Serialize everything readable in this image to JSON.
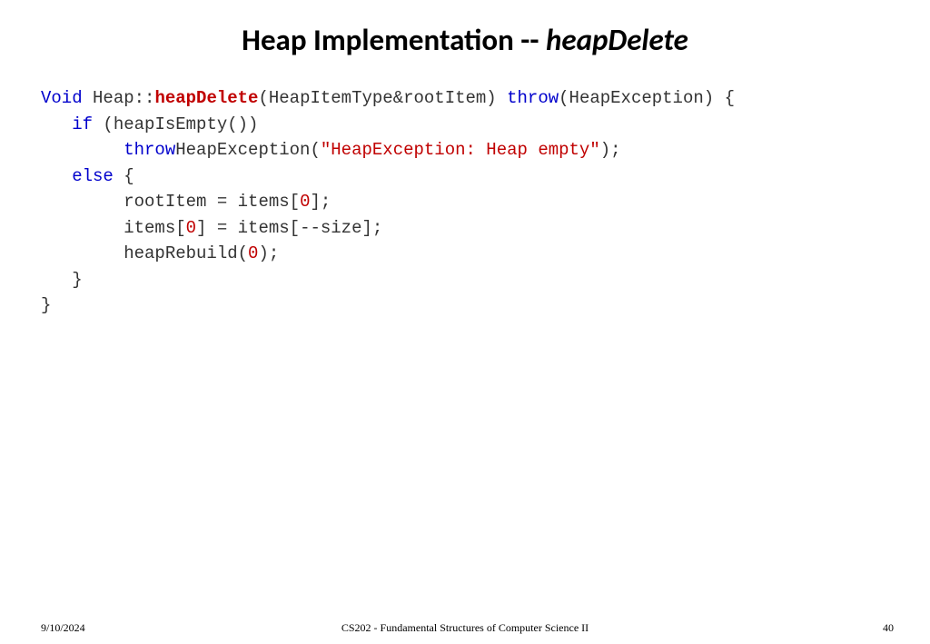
{
  "title": {
    "prefix": "Heap Implementation -- ",
    "italic": "heapDelete"
  },
  "code": {
    "l1": {
      "void": "Void",
      "txt1": " Heap::",
      "method": "heapDelete",
      "txt2": "(HeapItemType&rootItem) ",
      "throw": "throw",
      "txt3": "(HeapException) {"
    },
    "l2": {
      "indent": "   ",
      "if": "if",
      "txt": " (heapIsEmpty())"
    },
    "l3": {
      "indent": "        ",
      "throw": "throw",
      "txt1": "HeapException(",
      "str": "\"HeapException: Heap empty\"",
      "txt2": ");"
    },
    "l4": {
      "indent": "   ",
      "else": "else",
      "txt": " {"
    },
    "l5": {
      "indent": "        ",
      "txt1": "rootItem = items[",
      "num": "0",
      "txt2": "];"
    },
    "l6": {
      "indent": "        ",
      "txt1": "items[",
      "num": "0",
      "txt2": "] = items[--size];"
    },
    "l7": {
      "indent": "        ",
      "txt1": "heapRebuild(",
      "num": "0",
      "txt2": ");"
    },
    "l8": {
      "indent": "   ",
      "txt": "}"
    },
    "l9": {
      "txt": "}"
    }
  },
  "footer": {
    "date": "9/10/2024",
    "course": "CS202 - Fundamental Structures of Computer Science II",
    "page": "40"
  }
}
